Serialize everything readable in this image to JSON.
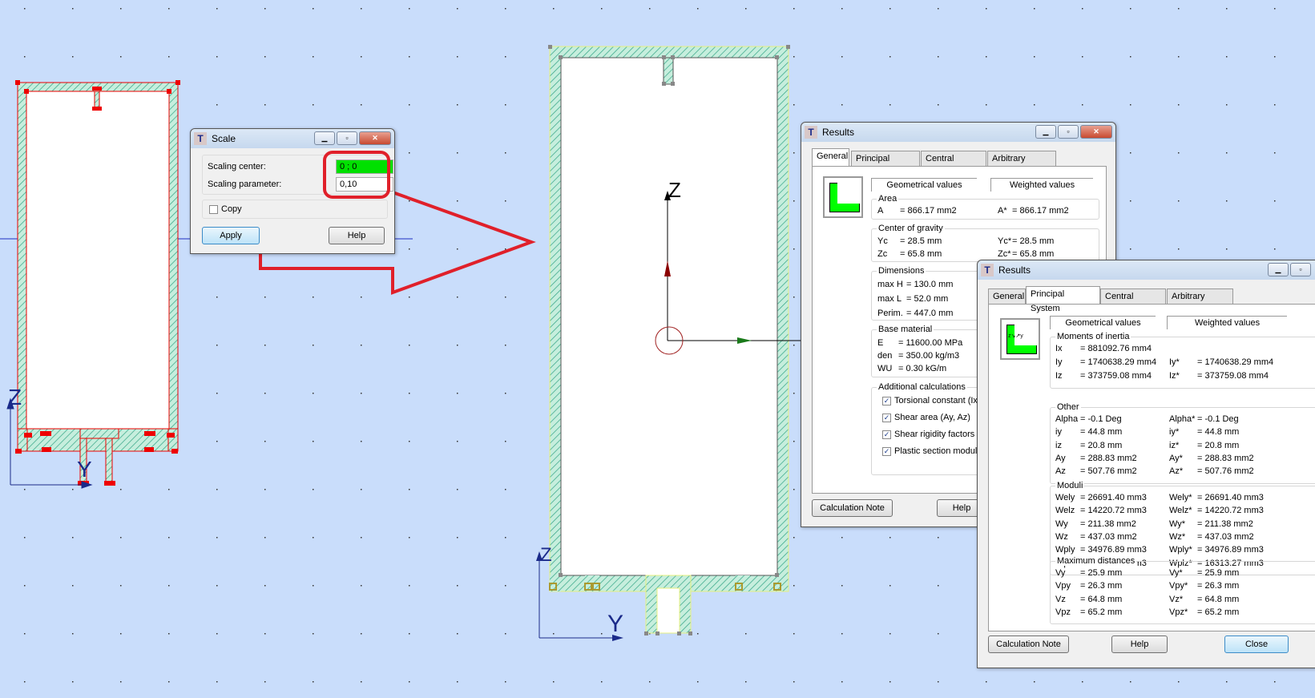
{
  "canvas": {
    "background": "#c9ddfb",
    "wall_color": "#8fd8c8",
    "node_color": "#e00000",
    "annotation_color": "#e0202a",
    "axis_labels": {
      "left_z": "Z",
      "left_y": "Y",
      "center_z": "Z",
      "center_bottom_z": "Z",
      "center_bottom_y": "Y"
    }
  },
  "scale_dialog": {
    "title": "Scale",
    "scaling_center_label": "Scaling center:",
    "scaling_center_value": "0 ; 0",
    "scaling_parameter_label": "Scaling parameter:",
    "scaling_parameter_value": "0,10",
    "copy_label": "Copy",
    "copy_checked": false,
    "apply_label": "Apply",
    "help_label": "Help"
  },
  "results1": {
    "title": "Results",
    "tabs": [
      "General",
      "Principal System",
      "Central System",
      "Arbitrary System"
    ],
    "active_tab": "General",
    "geom_header": "Geometrical values",
    "weighted_header": "Weighted values",
    "area": {
      "title": "Area",
      "rows": [
        {
          "k": "A",
          "v": "= 866.17 mm2",
          "k2": "A*",
          "v2": "= 866.17 mm2"
        }
      ]
    },
    "cog": {
      "title": "Center of gravity",
      "rows": [
        {
          "k": "Yc",
          "v": "= 28.5 mm",
          "k2": "Yc*",
          "v2": "= 28.5 mm"
        },
        {
          "k": "Zc",
          "v": "= 65.8 mm",
          "k2": "Zc*",
          "v2": "= 65.8 mm"
        }
      ]
    },
    "dimensions": {
      "title": "Dimensions",
      "rows": [
        {
          "k": "max H",
          "v": "= 130.0 mm"
        },
        {
          "k": "max L",
          "v": "= 52.0 mm"
        },
        {
          "k": "Perim.",
          "v": "= 447.0 mm"
        }
      ]
    },
    "material": {
      "title": "Base material",
      "rows": [
        {
          "k": "E",
          "v": "= 11600.00 MPa"
        },
        {
          "k": "den",
          "v": "= 350.00 kg/m3"
        },
        {
          "k": "WU",
          "v": "= 0.30 kG/m"
        }
      ]
    },
    "additional": {
      "title": "Additional calculations",
      "items": [
        "Torsional constant (Ix)",
        "Shear area (Ay, Az)",
        "Shear rigidity factors (W",
        "Plastic section moduli ("
      ]
    },
    "calc_note_label": "Calculation Note",
    "help_label": "Help"
  },
  "results2": {
    "title": "Results",
    "tabs": [
      "General",
      "Principal System",
      "Central System",
      "Arbitrary System"
    ],
    "active_tab": "Principal System",
    "geom_header": "Geometrical values",
    "weighted_header": "Weighted values",
    "groups": [
      {
        "title": "Moments of inertia",
        "rows": [
          {
            "k": "Ix",
            "v": "= 881092.76 mm4",
            "k2": "",
            "v2": ""
          },
          {
            "k": "Iy",
            "v": "= 1740638.29 mm4",
            "k2": "Iy*",
            "v2": "= 1740638.29 mm4"
          },
          {
            "k": "Iz",
            "v": "= 373759.08 mm4",
            "k2": "Iz*",
            "v2": "= 373759.08 mm4"
          }
        ]
      },
      {
        "title": "Other",
        "rows": [
          {
            "k": "Alpha",
            "v": "= -0.1 Deg",
            "k2": "Alpha*",
            "v2": "= -0.1 Deg"
          },
          {
            "k": "iy",
            "v": "= 44.8 mm",
            "k2": "iy*",
            "v2": "= 44.8 mm"
          },
          {
            "k": "iz",
            "v": "= 20.8 mm",
            "k2": "iz*",
            "v2": "= 20.8 mm"
          },
          {
            "k": "Ay",
            "v": "= 288.83 mm2",
            "k2": "Ay*",
            "v2": "= 288.83 mm2"
          },
          {
            "k": "Az",
            "v": "= 507.76 mm2",
            "k2": "Az*",
            "v2": "= 507.76 mm2"
          }
        ]
      },
      {
        "title": "Moduli",
        "rows": [
          {
            "k": "Wely",
            "v": "= 26691.40 mm3",
            "k2": "Wely*",
            "v2": "= 26691.40 mm3"
          },
          {
            "k": "Welz",
            "v": "= 14220.72 mm3",
            "k2": "Welz*",
            "v2": "= 14220.72 mm3"
          },
          {
            "k": "Wy",
            "v": "= 211.38 mm2",
            "k2": "Wy*",
            "v2": "= 211.38 mm2"
          },
          {
            "k": "Wz",
            "v": "= 437.03 mm2",
            "k2": "Wz*",
            "v2": "= 437.03 mm2"
          },
          {
            "k": "Wply",
            "v": "= 34976.89 mm3",
            "k2": "Wply*",
            "v2": "= 34976.89 mm3"
          },
          {
            "k": "Wplz",
            "v": "= 16313.27 mm3",
            "k2": "Wplz*",
            "v2": "= 16313.27 mm3"
          }
        ]
      },
      {
        "title": "Maximum distances",
        "rows": [
          {
            "k": "Vy",
            "v": "= 25.9 mm",
            "k2": "Vy*",
            "v2": "= 25.9 mm"
          },
          {
            "k": "Vpy",
            "v": "= 26.3 mm",
            "k2": "Vpy*",
            "v2": "= 26.3 mm"
          },
          {
            "k": "Vz",
            "v": "= 64.8 mm",
            "k2": "Vz*",
            "v2": "= 64.8 mm"
          },
          {
            "k": "Vpz",
            "v": "= 65.2 mm",
            "k2": "Vpz*",
            "v2": "= 65.2 mm"
          }
        ]
      }
    ],
    "calc_note_label": "Calculation Note",
    "help_label": "Help",
    "close_label": "Close"
  }
}
